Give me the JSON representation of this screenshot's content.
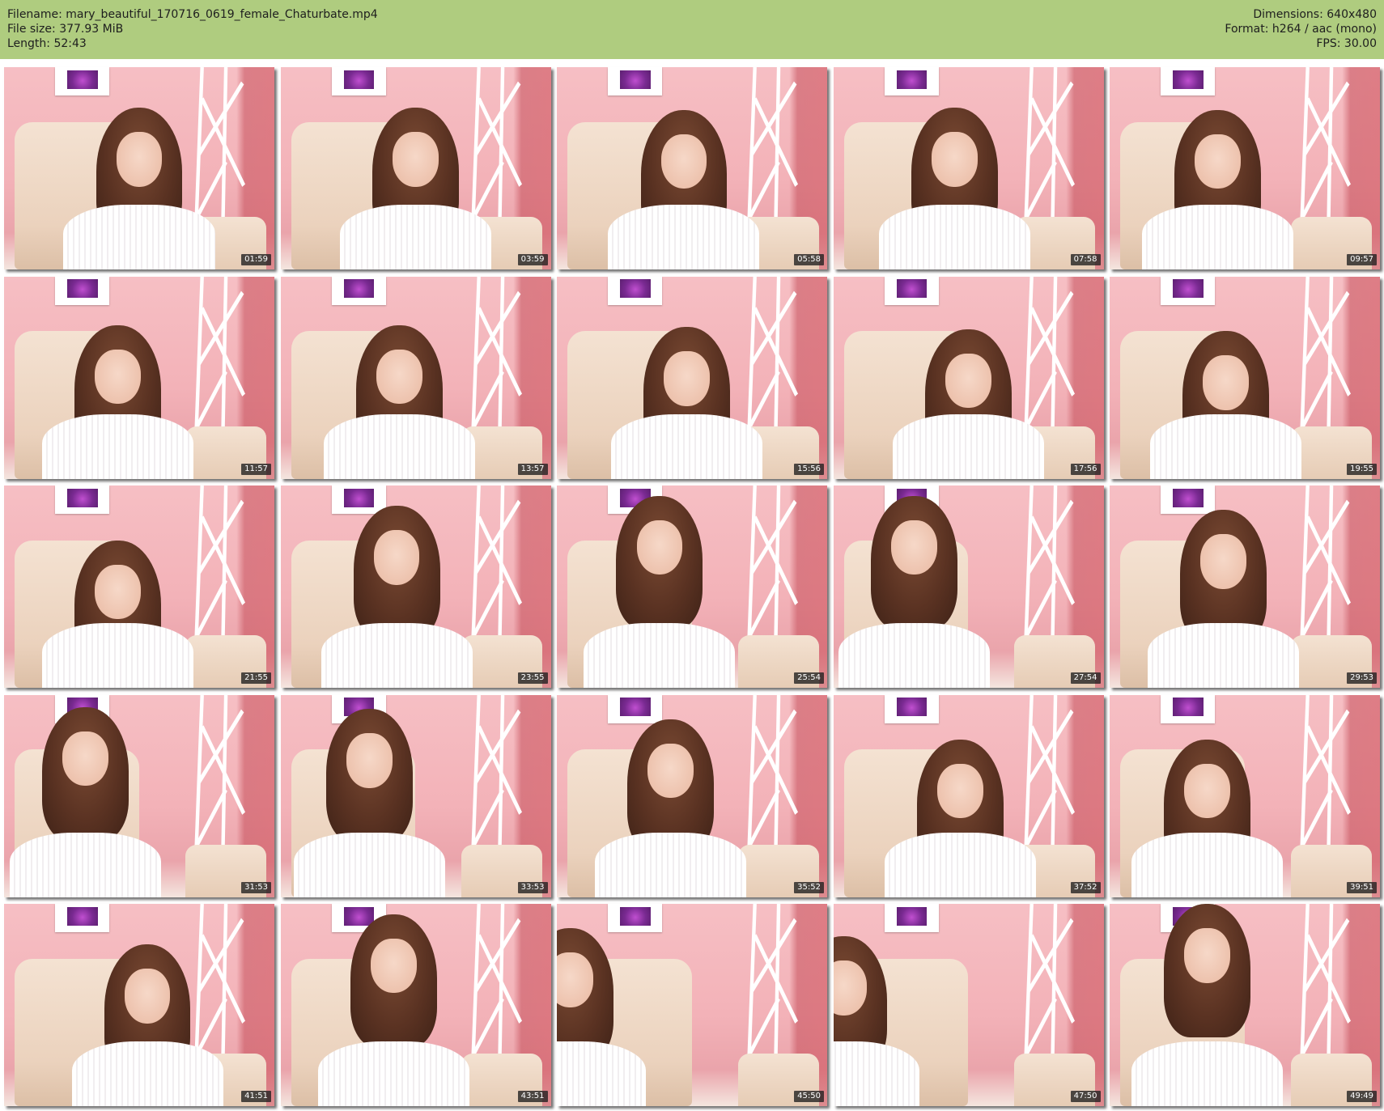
{
  "header": {
    "filename_label": "Filename: mary_beautiful_170716_0619_female_Chaturbate.mp4",
    "filesize_label": "File size: 377.93 MiB",
    "length_label": "Length: 52:43",
    "dimensions_label": "Dimensions: 640x480",
    "format_label": "Format: h264 / aac (mono)",
    "fps_label": "FPS: 30.00"
  },
  "colors": {
    "header_bg": "#afcc7f",
    "wall_pink": "#f3b2b8",
    "sweater_white": "#ffffff",
    "hair_brown": "#5a3222"
  },
  "thumbnails": [
    {
      "timestamp": "01:59"
    },
    {
      "timestamp": "03:59"
    },
    {
      "timestamp": "05:58"
    },
    {
      "timestamp": "07:58"
    },
    {
      "timestamp": "09:57"
    },
    {
      "timestamp": "11:57"
    },
    {
      "timestamp": "13:57"
    },
    {
      "timestamp": "15:56"
    },
    {
      "timestamp": "17:56"
    },
    {
      "timestamp": "19:55"
    },
    {
      "timestamp": "21:55"
    },
    {
      "timestamp": "23:55"
    },
    {
      "timestamp": "25:54"
    },
    {
      "timestamp": "27:54"
    },
    {
      "timestamp": "29:53"
    },
    {
      "timestamp": "31:53"
    },
    {
      "timestamp": "33:53"
    },
    {
      "timestamp": "35:52"
    },
    {
      "timestamp": "37:52"
    },
    {
      "timestamp": "39:51"
    },
    {
      "timestamp": "41:51"
    },
    {
      "timestamp": "43:51"
    },
    {
      "timestamp": "45:50"
    },
    {
      "timestamp": "47:50"
    },
    {
      "timestamp": "49:49"
    }
  ]
}
